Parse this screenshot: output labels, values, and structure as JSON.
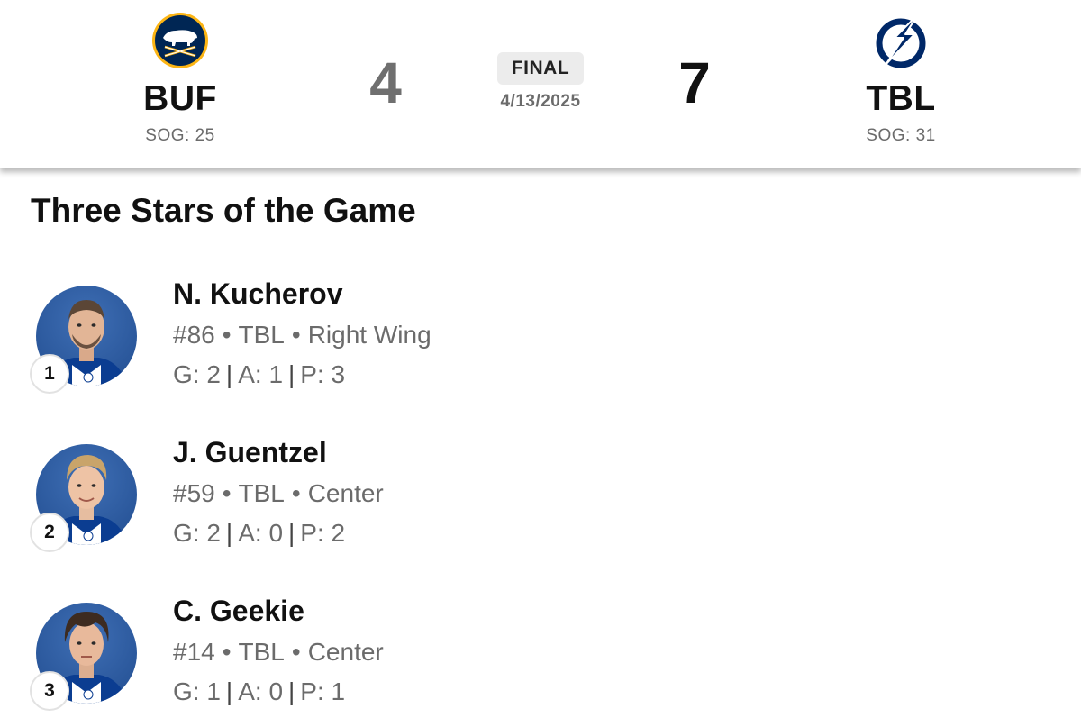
{
  "game": {
    "away": {
      "abbr": "BUF",
      "sog": "SOG: 25",
      "score": "4",
      "logo": "sabres-logo",
      "color": "#002654"
    },
    "home": {
      "abbr": "TBL",
      "sog": "SOG: 31",
      "score": "7",
      "logo": "lightning-logo",
      "color": "#002868"
    },
    "status": "FINAL",
    "date": "4/13/2025"
  },
  "section_title": "Three Stars of the Game",
  "stars": [
    {
      "rank": "1",
      "name": "N. Kucherov",
      "number": "#86",
      "team": "TBL",
      "position": "Right Wing",
      "g": "G: 2",
      "a": "A: 1",
      "p": "P: 3"
    },
    {
      "rank": "2",
      "name": "J. Guentzel",
      "number": "#59",
      "team": "TBL",
      "position": "Center",
      "g": "G: 2",
      "a": "A: 0",
      "p": "P: 2"
    },
    {
      "rank": "3",
      "name": "C. Geekie",
      "number": "#14",
      "team": "TBL",
      "position": "Center",
      "g": "G: 1",
      "a": "A: 0",
      "p": "P: 1"
    }
  ],
  "colors": {
    "headshot_bg": "#2a579b",
    "muted_text": "#6b6b6b",
    "badge_bg": "#ececec"
  }
}
